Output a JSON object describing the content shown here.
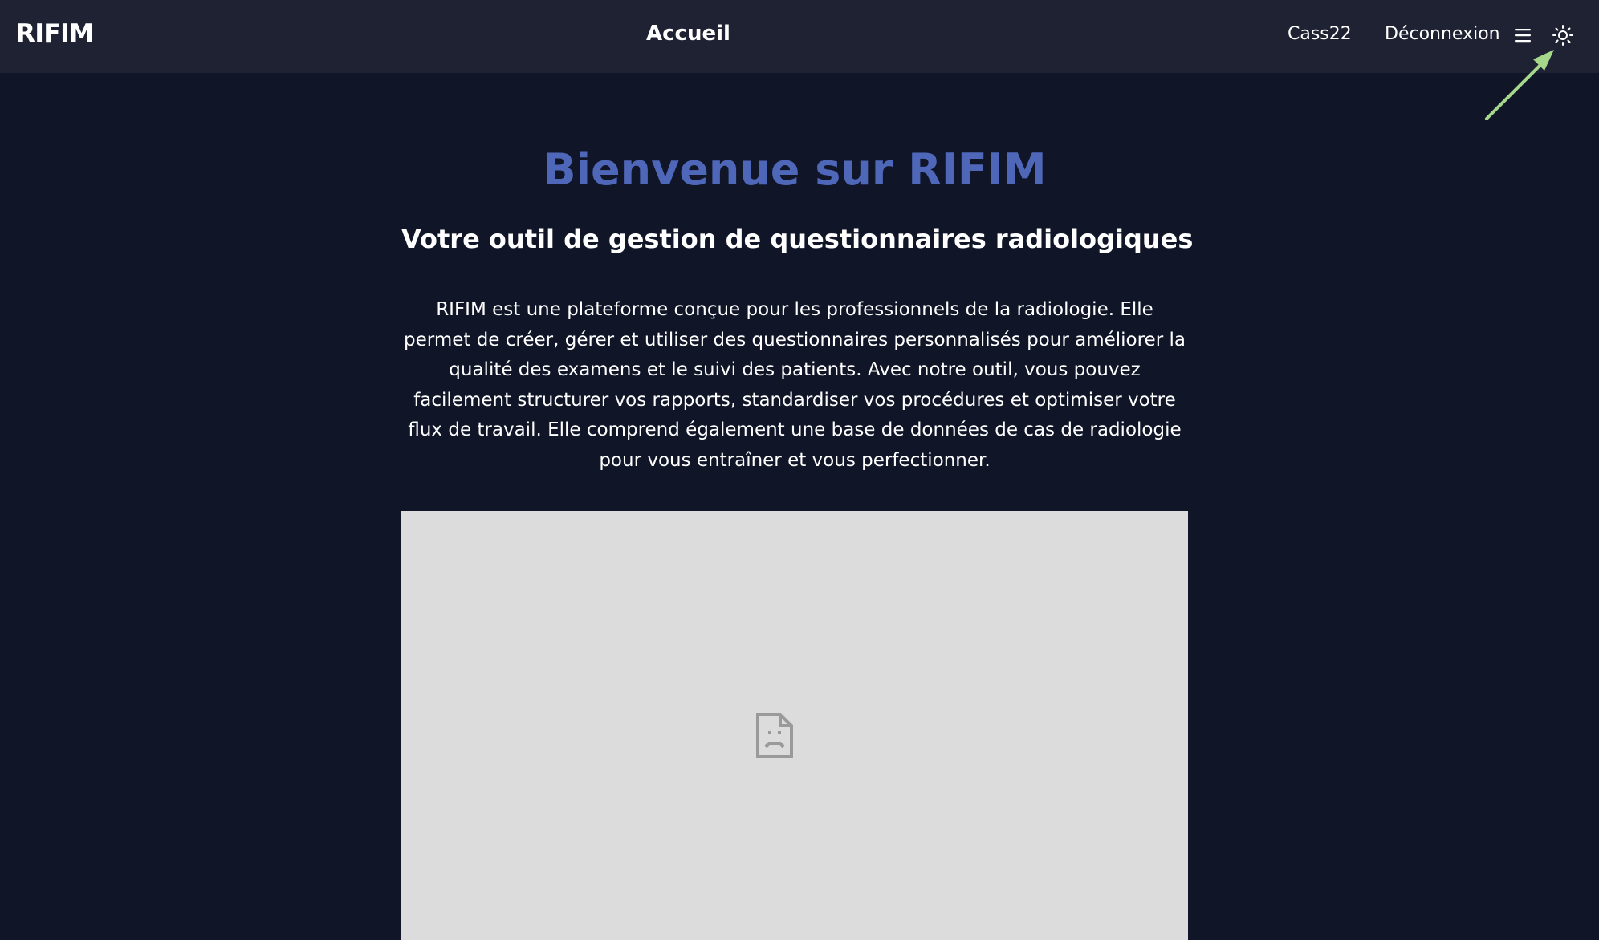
{
  "navbar": {
    "brand": "RIFIM",
    "title": "Accueil",
    "user_link": "Cass22",
    "logout_link": "Déconnexion",
    "menu_icon": "hamburger-menu-icon",
    "theme_icon": "sun-icon"
  },
  "main": {
    "headline": "Bienvenue sur RIFIM",
    "subheadline": "Votre outil de gestion de questionnaires radiologiques",
    "description": "RIFIM est une plateforme conçue pour les professionnels de la radiologie. Elle permet de créer, gérer et utiliser des questionnaires personnalisés pour améliorer la qualité des examens et le suivi des patients. Avec notre outil, vous pouvez facilement structurer vos rapports, standardiser vos procédures et optimiser votre flux de travail. Elle comprend également une base de données de cas de radiologie pour vous entraîner et vous perfectionner.",
    "media_icon": "broken-document-icon"
  },
  "annotation": {
    "icon": "arrow-icon"
  },
  "colors": {
    "page_background": "#101628",
    "navbar_background": "#1e2232",
    "headline": "#4f67b9",
    "media_placeholder": "#dcdcdc",
    "annotation_arrow": "#a6d88c"
  }
}
